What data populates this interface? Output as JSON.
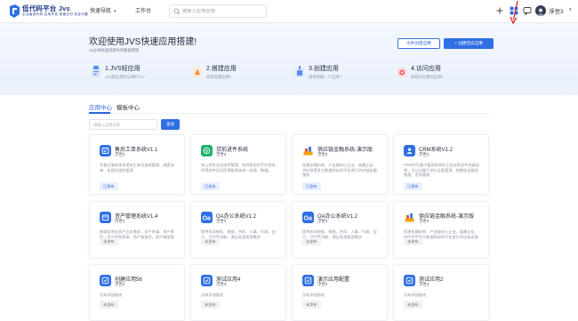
{
  "header": {
    "logo_title": "低代码平台 Jvs",
    "logo_subtitle": "企业级低代码 应用开发 快速交付 安全可靠",
    "quick_nav": "快速导航",
    "workbench": "工作台",
    "search_placeholder": "搜索入应用名称",
    "user_name": "浮世3",
    "icons": [
      "plus-icon",
      "apps-grid-icon",
      "message-icon",
      "chevron-down-icon"
    ],
    "highlight_color": "#e02020"
  },
  "banner": {
    "title": "欢迎使用JVS快速应用搭建!",
    "subtitle": "10分钟快速搭建你的数据管理",
    "btn_create_system": "文件创建应用",
    "btn_create_blank": "+ 创建空白应用",
    "steps": [
      {
        "title": "1.JVS轻应用",
        "desc": "JVS轻应用可以用什么?"
      },
      {
        "title": "2.搭建应用",
        "desc": "如何搭建应用?"
      },
      {
        "title": "3.创建应用",
        "desc": "如何创建一个应用?"
      },
      {
        "title": "4.访问应用",
        "desc": "如何访问我的应用?"
      }
    ]
  },
  "main": {
    "tabs": [
      "应用中心",
      "模板中心"
    ],
    "search_placeholder": "请输入应用名称",
    "search_button": "查询",
    "cards": [
      {
        "title": "售后工单系统V1.1",
        "owner": "浮世3",
        "desc": "为售后服务体系提供工单全流程管理、调度派单、处理反馈的管理",
        "badge": "已发布",
        "icon": "ticket-icon",
        "color": "#2f6fe4"
      },
      {
        "title": "贷前进件系统",
        "owner": "浮世3",
        "desc": "线上贷款业务进件管理，各种类型信手应答程序等进件及风险等级筛选统一处理、数据。",
        "badge": "已发布",
        "icon": "loan-icon",
        "color": "#1fb36a"
      },
      {
        "title": "供应链金融系统-演示版",
        "owner": "浮世3",
        "desc": "搭建金融机构、产业链核心企业、链属企业、供应商等多方数据的协同平台进行供应链金融服务",
        "badge": "已发布",
        "icon": "supply-chain-icon",
        "color": "#e8542e"
      },
      {
        "title": "CRM系统V1.2",
        "owner": "浮世3",
        "desc": "CRM作为客户管理系统在企业信息化中发展较快，可以对客户进行全面管理，销售机会跟进管理、合同管理",
        "badge": "已发布",
        "icon": "crm-icon",
        "color": "#2f6fe4"
      },
      {
        "title": "资产管理系统V1.4",
        "owner": "浮世3",
        "desc": "根据信息化资产业务需求，资产申请、资产审批、资产采购系统、资产管理员，资产借用管理系统",
        "badge": "未发布",
        "icon": "asset-icon",
        "color": "#2f6fe4"
      },
      {
        "title": "OA办公系统V1.2",
        "owner": "浮世3",
        "desc": "提供协同审批、报销、合同、人事、行政、会议、项目等功能，满足各类管理需求",
        "badge": "未发布",
        "icon": "oa-icon",
        "color": "#2f6fe4"
      },
      {
        "title": "OA办公系统V1.2",
        "owner": "浮世3",
        "desc": "提供协同审批、报销、合同、人事、行政、会议、项目等功能，满足各类管理需求",
        "badge": "未发布",
        "icon": "oa-icon",
        "color": "#2f6fe4"
      },
      {
        "title": "供应链金融系统-演示版",
        "owner": "浮世3",
        "desc": "搭建金融机构、产业链核心企业、链属企业、供应商等多方数据的协同平台进行供应链金融服务",
        "badge": "未发布",
        "icon": "supply-chain-icon",
        "color": "#e8542e"
      },
      {
        "title": "创建应用56",
        "owner": "浮世3",
        "desc": "没有添加描述",
        "badge": "未发布",
        "icon": "app-icon",
        "color": "#2f6fe4"
      },
      {
        "title": "测试应用4",
        "owner": "浮世3",
        "desc": "没有添加描述",
        "badge": "未发布",
        "icon": "app-icon",
        "color": "#2f6fe4"
      },
      {
        "title": "演示应用配置",
        "owner": "浮世3",
        "desc": "没有添加描述",
        "badge": "未发布",
        "icon": "app-icon",
        "color": "#2f6fe4"
      },
      {
        "title": "测试应用2",
        "owner": "浮世3",
        "desc": "没有添加描述",
        "badge": "未发布",
        "icon": "app-icon",
        "color": "#2f6fe4"
      }
    ]
  }
}
